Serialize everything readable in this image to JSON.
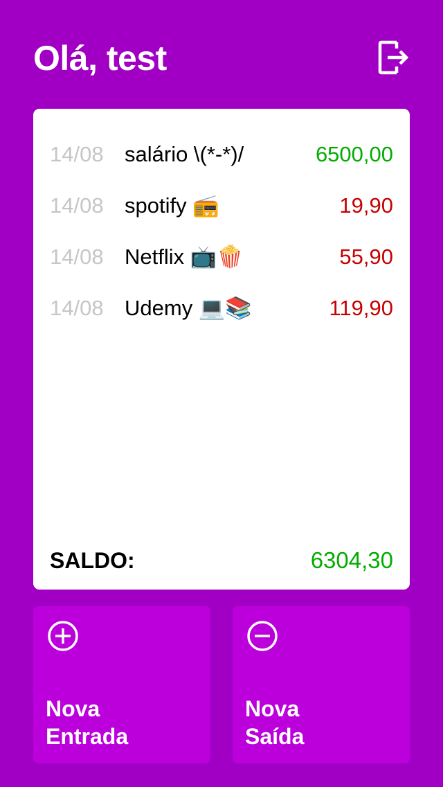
{
  "header": {
    "greeting": "Olá, test",
    "logout_icon": "logout-icon"
  },
  "colors": {
    "background": "#a100c4",
    "button_background": "#bb00dc",
    "positive": "#03ac00",
    "negative": "#c70000",
    "date": "#c6c6c6"
  },
  "entries": [
    {
      "date": "14/08",
      "description": "salário \\(*-*)/",
      "value": "6500,00",
      "type": "entrada"
    },
    {
      "date": "14/08",
      "description": "spotify 📻",
      "value": "19,90",
      "type": "saida"
    },
    {
      "date": "14/08",
      "description": "Netflix 📺🍿",
      "value": "55,90",
      "type": "saida"
    },
    {
      "date": "14/08",
      "description": "Udemy 💻📚",
      "value": "119,90",
      "type": "saida"
    }
  ],
  "saldo": {
    "label": "SALDO:",
    "value": "6304,30"
  },
  "actions": {
    "nova_entrada": {
      "line1": "Nova",
      "line2": "Entrada",
      "icon": "plus-circle-icon"
    },
    "nova_saida": {
      "line1": "Nova",
      "line2": "Saída",
      "icon": "minus-circle-icon"
    }
  }
}
